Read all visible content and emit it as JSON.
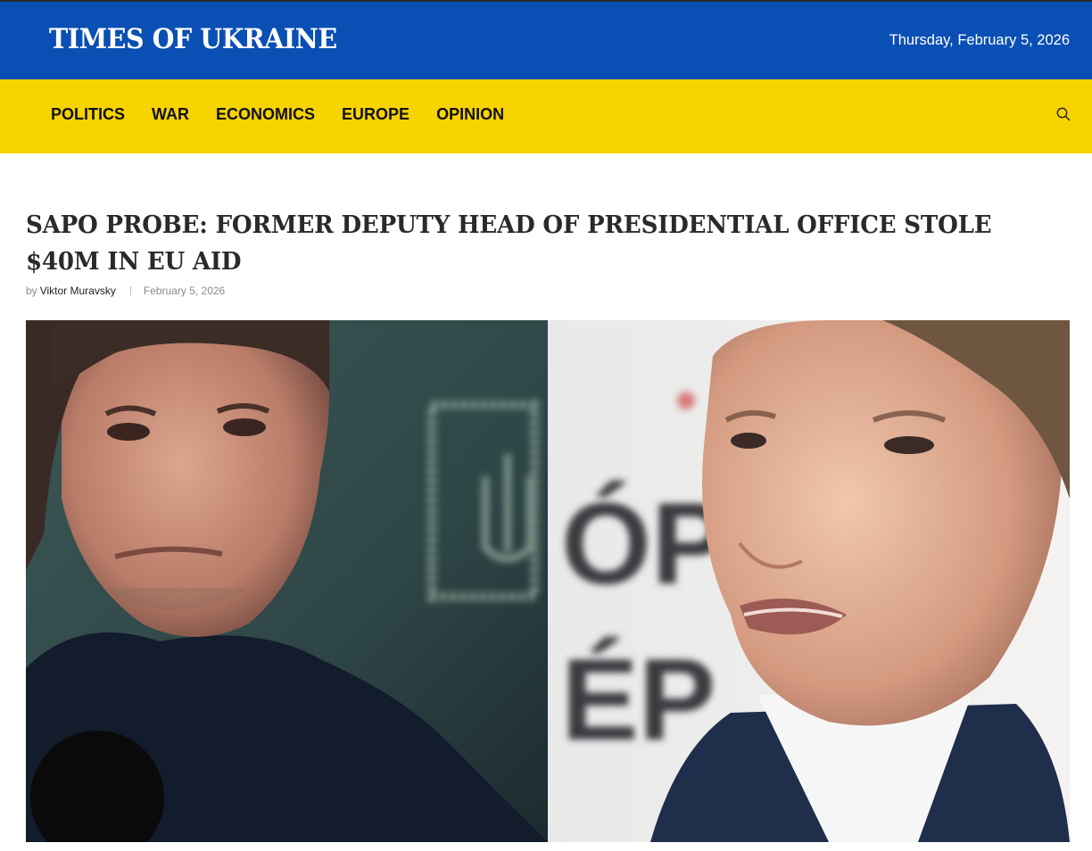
{
  "site": {
    "logo": "TIMES OF UKRAINE",
    "date": "Thursday, February 5, 2026"
  },
  "nav": {
    "items": [
      {
        "label": "POLITICS"
      },
      {
        "label": "WAR"
      },
      {
        "label": "ECONOMICS"
      },
      {
        "label": "EUROPE"
      },
      {
        "label": "OPINION"
      }
    ],
    "search_icon": "search-icon"
  },
  "article": {
    "title": "SAPO PROBE: FORMER DEPUTY HEAD OF PRESIDENTIAL OFFICE STOLE $40M IN EU AID",
    "by": "by",
    "author": "Viktor Muravsky",
    "date": "February 5, 2026",
    "image_text_left": "",
    "image_text_right_1": "ÓPA",
    "image_text_right_2": "ÉP"
  },
  "colors": {
    "header_blue": "#0a4fb4",
    "nav_yellow": "#f7d300"
  }
}
